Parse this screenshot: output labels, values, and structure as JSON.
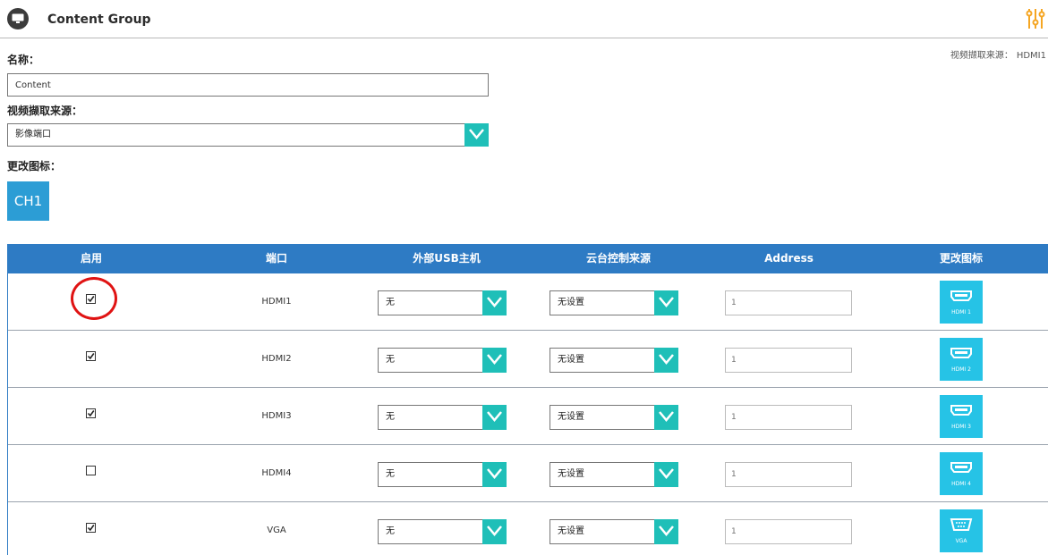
{
  "header": {
    "title": "Content Group",
    "logo_icon": "monitor-icon",
    "settings_icon": "sliders-icon",
    "accent_color": "#f5a623"
  },
  "source_info": {
    "label": "视频撷取来源：",
    "value": "HDMI1"
  },
  "form": {
    "name_label": "名称：",
    "name_value": "Content",
    "source_label": "视频撷取来源：",
    "source_value": "影像端口",
    "icon_label": "更改图标：",
    "icon_text": "CH1"
  },
  "table": {
    "headers": [
      "启用",
      "端口",
      "外部USB主机",
      "云台控制来源",
      "Address",
      "更改图标"
    ],
    "rows": [
      {
        "enabled": true,
        "port": "HDMI1",
        "usb": "无",
        "ptz": "无设置",
        "address_placeholder": "1",
        "icon_label": "HDMI 1",
        "icon": "hdmi-port-icon"
      },
      {
        "enabled": true,
        "port": "HDMI2",
        "usb": "无",
        "ptz": "无设置",
        "address_placeholder": "1",
        "icon_label": "HDMI 2",
        "icon": "hdmi-port-icon"
      },
      {
        "enabled": true,
        "port": "HDMI3",
        "usb": "无",
        "ptz": "无设置",
        "address_placeholder": "1",
        "icon_label": "HDMI 3",
        "icon": "hdmi-port-icon"
      },
      {
        "enabled": false,
        "port": "HDMI4",
        "usb": "无",
        "ptz": "无设置",
        "address_placeholder": "1",
        "icon_label": "HDMI 4",
        "icon": "hdmi-port-icon"
      },
      {
        "enabled": true,
        "port": "VGA",
        "usb": "无",
        "ptz": "无设置",
        "address_placeholder": "1",
        "icon_label": "VGA",
        "icon": "vga-port-icon"
      }
    ]
  },
  "colors": {
    "table_header": "#2e7bc4",
    "dropdown_arrow": "#1fbfb8",
    "icon_tile": "#26c3e6",
    "ch1_tile": "#2c9dd5",
    "highlight": "#e01313"
  }
}
